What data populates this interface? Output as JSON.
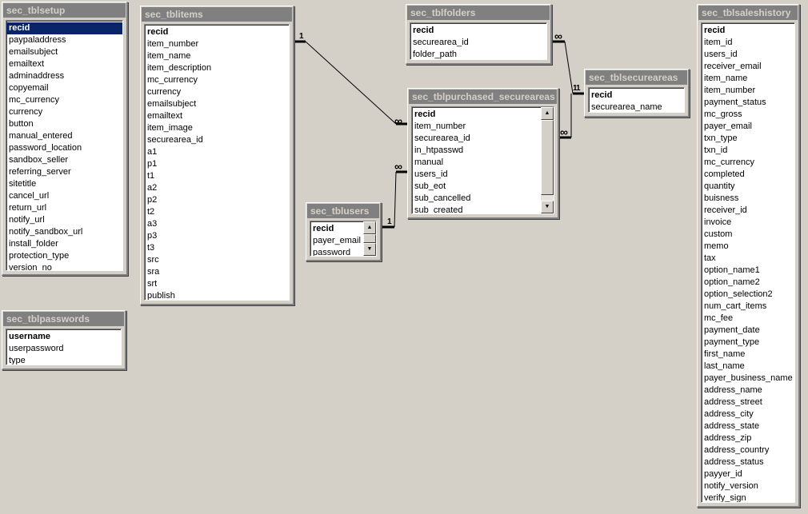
{
  "tables": {
    "setup": {
      "title": "sec_tblsetup",
      "fields": [
        "recid",
        "paypaladdress",
        "emailsubject",
        "emailtext",
        "adminaddress",
        "copyemail",
        "mc_currency",
        "currency",
        "button",
        "manual_entered",
        "password_location",
        "sandbox_seller",
        "referring_server",
        "sitetitle",
        "cancel_url",
        "return_url",
        "notify_url",
        "notify_sandbox_url",
        "install_folder",
        "protection_type",
        "version_no"
      ]
    },
    "passwords": {
      "title": "sec_tblpasswords",
      "fields": [
        "username",
        "userpassword",
        "type"
      ]
    },
    "items": {
      "title": "sec_tblitems",
      "fields": [
        "recid",
        "item_number",
        "item_name",
        "item_description",
        "mc_currency",
        "currency",
        "emailsubject",
        "emailtext",
        "item_image",
        "securearea_id",
        "a1",
        "p1",
        "t1",
        "a2",
        "p2",
        "t2",
        "a3",
        "p3",
        "t3",
        "src",
        "sra",
        "srt",
        "publish"
      ]
    },
    "folders": {
      "title": "sec_tblfolders",
      "fields": [
        "recid",
        "securearea_id",
        "folder_path"
      ]
    },
    "purchased": {
      "title": "sec_tblpurchased_secureareas",
      "fields": [
        "recid",
        "item_number",
        "securearea_id",
        "in_htpasswd",
        "manual",
        "users_id",
        "sub_eot",
        "sub_cancelled",
        "sub_created"
      ]
    },
    "users": {
      "title": "sec_tblusers",
      "fields": [
        "recid",
        "payer_email",
        "password"
      ]
    },
    "secureareas": {
      "title": "sec_tblsecureareas",
      "fields": [
        "recid",
        "securearea_name"
      ]
    },
    "saleshistory": {
      "title": "sec_tblsaleshistory",
      "fields": [
        "recid",
        "item_id",
        "users_id",
        "receiver_email",
        "item_name",
        "item_number",
        "payment_status",
        "mc_gross",
        "payer_email",
        "txn_type",
        "txn_id",
        "mc_currency",
        "completed",
        "quantity",
        "buisness",
        "receiver_id",
        "invoice",
        "custom",
        "memo",
        "tax",
        "option_name1",
        "option_name2",
        "option_selection2",
        "num_cart_items",
        "mc_fee",
        "payment_date",
        "payment_type",
        "first_name",
        "last_name",
        "payer_business_name",
        "address_name",
        "address_street",
        "address_city",
        "address_state",
        "address_zip",
        "address_country",
        "address_status",
        "payyer_id",
        "notify_version",
        "verify_sign"
      ]
    }
  },
  "relationships": [
    {
      "from_label": "1",
      "to_label": "∞"
    },
    {
      "from_label": "1",
      "to_label": "∞"
    },
    {
      "from_label": "∞",
      "to_label": "1"
    },
    {
      "from_label": "∞",
      "to_label": "1"
    }
  ],
  "icons": {
    "scroll_up": "scroll-up-arrow-icon",
    "scroll_down": "scroll-down-arrow-icon"
  },
  "colors": {
    "background": "#d4d0c8",
    "title_bar": "#808080",
    "selection": "#0a246a"
  }
}
